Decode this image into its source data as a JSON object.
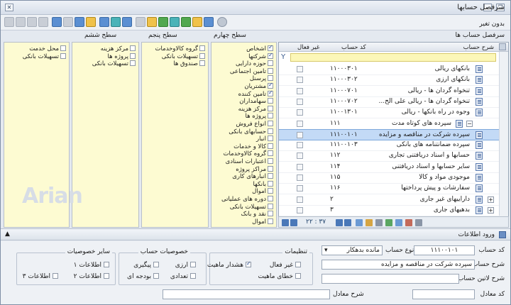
{
  "window": {
    "title": "سرفصل حسابها",
    "status_label": "بدون تغیر"
  },
  "sections": {
    "accounts": "سرفصل حساب ها",
    "level4": "سطح چهارم",
    "level5": "سطح پنجم",
    "level6": "سطح ششم"
  },
  "grid": {
    "col_name": "شرح حساب",
    "col_code": "کد حساب",
    "col_inactive": "غیر فعال",
    "rows": [
      {
        "name": "بانکهای ریالی",
        "code": "۱۱۰۰۰۳۰۱"
      },
      {
        "name": "بانکهای ارزی",
        "code": "۱۱۰۰۰۳۰۲"
      },
      {
        "name": "تنخواه گردان ها - ریالی",
        "code": "۱۱۰۰۰۷۰۱"
      },
      {
        "name": "تنخواه گردان ها - ریالی علی الح...",
        "code": "۱۱۰۰۰۷۰۲"
      },
      {
        "name": "وجوه در راه بانکها - ریالی",
        "code": "۱۱۰۰۱۳۰۱"
      },
      {
        "name": "سپرده های کوتاه مدت",
        "code": "۱۱۱"
      },
      {
        "name": "سپرده شرکت در مناقصه و مزایده",
        "code": "۱۱۱۰۰۱۰۱"
      },
      {
        "name": "سپرده ضمانتنامه های بانکی",
        "code": "۱۱۱۰۰۱۰۳"
      },
      {
        "name": "حسابها و اسناد دریافتنی تجاری",
        "code": "۱۱۲"
      },
      {
        "name": "سایر حسابها و اسناد دریافتنی",
        "code": "۱۱۴"
      },
      {
        "name": "موجودی مواد و کالا",
        "code": "۱۱۵"
      },
      {
        "name": "سفارشات و پیش پرداختها",
        "code": "۱۱۶"
      },
      {
        "name": "داراییهای غیر جاری",
        "code": "۲"
      },
      {
        "name": "بدهیهای جاری",
        "code": "۳"
      }
    ],
    "counter": "۲۲ : ۳۷"
  },
  "level4": [
    {
      "label": "اشخاص",
      "checked": true
    },
    {
      "label": "شرکتها",
      "checked": true
    },
    {
      "label": "حوزه دارایی",
      "checked": false
    },
    {
      "label": "تامین اجتماعی",
      "checked": false
    },
    {
      "label": "پرسنل",
      "checked": false
    },
    {
      "label": "مشتریان",
      "checked": true
    },
    {
      "label": "تامین کننده",
      "checked": true
    },
    {
      "label": "سهامداران",
      "checked": false
    },
    {
      "label": "مرکز هزینه",
      "checked": false
    },
    {
      "label": "پروژه ها",
      "checked": false
    },
    {
      "label": "انواع فروش",
      "checked": false
    },
    {
      "label": "حسابهای بانکی",
      "checked": false
    },
    {
      "label": "انبار",
      "checked": false
    },
    {
      "label": "کالا و خدمات",
      "checked": false
    },
    {
      "label": "گروه کالاوخدمات",
      "checked": false
    },
    {
      "label": "اعتبارات اسنادی",
      "checked": false
    },
    {
      "label": "مراکز پروژه",
      "checked": false
    },
    {
      "label": "انبارهای کاری",
      "checked": false
    },
    {
      "label": "بانکها",
      "checked": false
    },
    {
      "label": "اموال",
      "checked": false
    },
    {
      "label": "دوره های عملیاتی",
      "checked": false
    },
    {
      "label": "تسهیلات بانکی",
      "checked": false
    },
    {
      "label": "نقد و بانک",
      "checked": false
    },
    {
      "label": "اموال",
      "checked": false
    }
  ],
  "level5": [
    {
      "label": "گروه کالاوخدمات",
      "checked": false
    },
    {
      "label": "تسهیلات بانکی",
      "checked": false
    },
    {
      "label": "صندوق ها",
      "checked": false
    }
  ],
  "level6": [
    {
      "label": "مرکز هزینه",
      "checked": false
    },
    {
      "label": "پروژه ها",
      "checked": false
    },
    {
      "label": "تسهیلات بانکی",
      "checked": false
    }
  ],
  "level7": [
    {
      "label": "محل خدمت",
      "checked": false
    },
    {
      "label": "تسهیلات بانکی",
      "checked": false
    }
  ],
  "info_section": {
    "title": "ورود اطلاعات"
  },
  "form": {
    "code_label": "کد حساب",
    "code_value": "۱۱۱۰۰۱۰۱",
    "type_label": "نوع حساب",
    "type_value": "مانده بدهکار",
    "desc_label": "شرح حساب",
    "desc_value": "سپرده شرکت در مناقصه و مزایده",
    "latin_label": "شرح لاتین حساب",
    "latin_value": "",
    "equiv_code_label": "کد معادل",
    "equiv_code_value": "",
    "equiv_desc_label": "شرح معادل",
    "equiv_desc_value": "",
    "settings_title": "تنظیمات",
    "settings": [
      {
        "label": "غیر فعال",
        "checked": false
      },
      {
        "label": "هشدار ماهیت",
        "checked": true
      },
      {
        "label": "خطای ماهیت",
        "checked": false
      }
    ],
    "props_title": "خصوصیات حساب",
    "props": [
      {
        "label": "ارزی",
        "checked": false
      },
      {
        "label": "پیگیری",
        "checked": false
      },
      {
        "label": "تعدادی",
        "checked": false
      },
      {
        "label": "بودجه ای",
        "checked": false
      }
    ],
    "other_title": "سایر خصوصیات",
    "other": [
      {
        "label": "اطلاعات ۱",
        "checked": false
      },
      {
        "label": "اطلاعات ۲",
        "checked": false
      },
      {
        "label": "اطلاعات ۳",
        "checked": false
      }
    ]
  },
  "brand": {
    "logo_text": "Arian"
  }
}
